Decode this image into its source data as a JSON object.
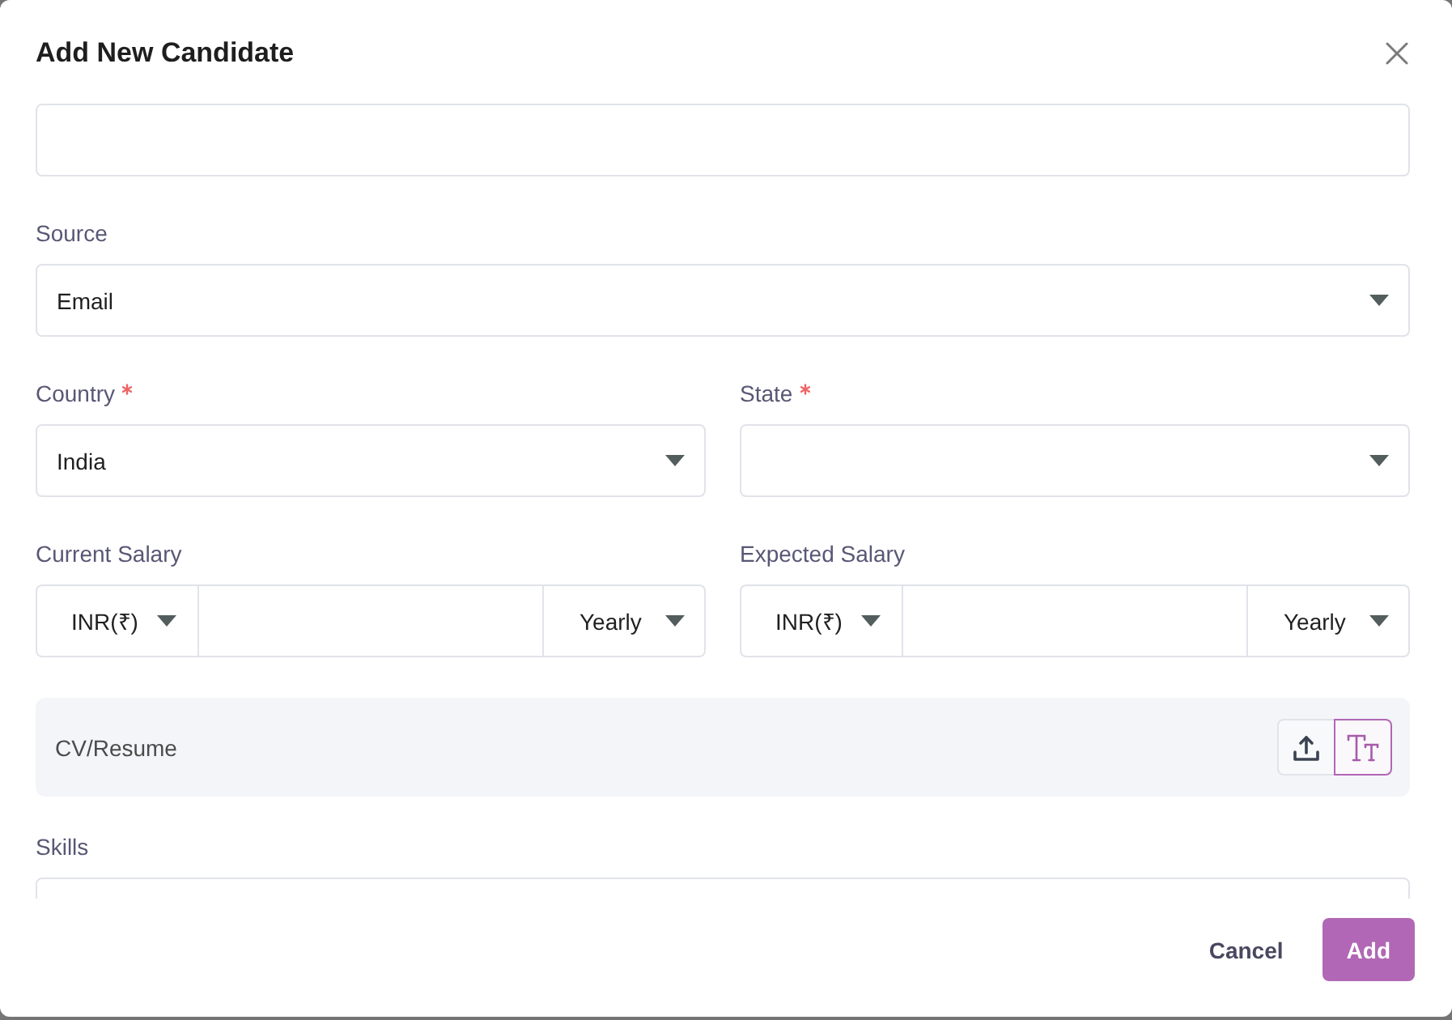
{
  "dialog": {
    "title": "Add New Candidate"
  },
  "form": {
    "rows": [
      {
        "fields": [
          {
            "kind": "text",
            "required": false
          }
        ]
      },
      {
        "fields": [
          {
            "kind": "select",
            "label": "Source",
            "required": false,
            "value": "Email"
          }
        ]
      },
      {
        "fields": [
          {
            "kind": "select",
            "label": "Country",
            "required": true,
            "value": "India"
          },
          {
            "kind": "select",
            "label": "State",
            "required": true
          }
        ]
      },
      {
        "fields": [
          {
            "kind": "salary",
            "label": "Current Salary",
            "required": false,
            "currency": "INR(₹)",
            "period": "Yearly"
          },
          {
            "kind": "salary",
            "label": "Expected Salary",
            "required": false,
            "currency": "INR(₹)",
            "period": "Yearly"
          }
        ]
      },
      {
        "fields": [
          {
            "kind": "upload",
            "label": "CV/Resume",
            "required": false,
            "modes": [
              {
                "kind": "upload",
                "selected": false
              },
              {
                "kind": "text",
                "selected": true
              }
            ]
          }
        ]
      },
      {
        "fields": [
          {
            "kind": "text",
            "label": "Skills",
            "required": false
          }
        ]
      }
    ]
  },
  "footer": {
    "buttons": [
      {
        "label": "Cancel",
        "kind": "secondary"
      },
      {
        "label": "Add",
        "kind": "primary"
      }
    ]
  }
}
